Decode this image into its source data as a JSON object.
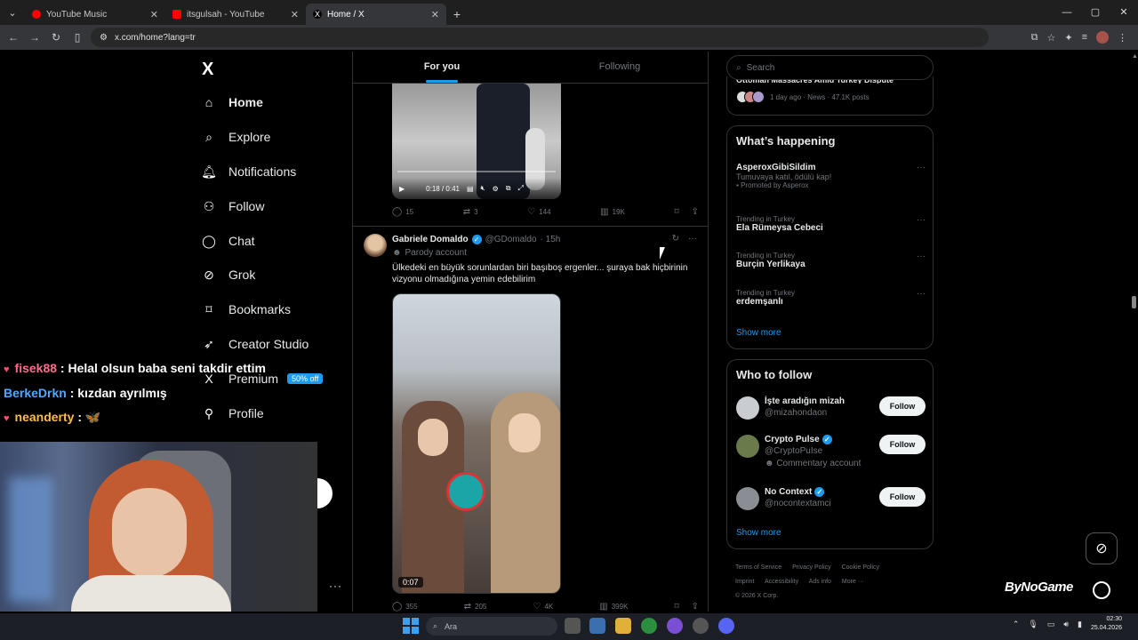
{
  "browser": {
    "tabs": [
      {
        "title": "YouTube Music",
        "favicon_color": "#ff0000",
        "active": false
      },
      {
        "title": "itsgulsah - YouTube",
        "favicon_color": "#ff0000",
        "active": false
      },
      {
        "title": "Home / X",
        "favicon_color": "#000000",
        "active": true
      }
    ],
    "url": "x.com/home?lang=tr"
  },
  "left_nav": {
    "logo": "X",
    "items": [
      {
        "label": "Home",
        "icon": "home-icon",
        "glyph": "⌂"
      },
      {
        "label": "Explore",
        "icon": "search-icon",
        "glyph": "⌕"
      },
      {
        "label": "Notifications",
        "icon": "bell-icon",
        "glyph": "♫"
      },
      {
        "label": "Follow",
        "icon": "add-user-icon",
        "glyph": "⚇"
      },
      {
        "label": "Chat",
        "icon": "chat-bubble-icon",
        "glyph": "◯"
      },
      {
        "label": "Grok",
        "icon": "grok-icon",
        "glyph": "⊘"
      },
      {
        "label": "Bookmarks",
        "icon": "bookmark-icon",
        "glyph": "⌑"
      },
      {
        "label": "Creator Studio",
        "icon": "rocket-icon",
        "glyph": "➶"
      },
      {
        "label": "Premium",
        "icon": "x-logo-icon",
        "glyph": "X"
      },
      {
        "label": "Profile",
        "icon": "person-icon",
        "glyph": "⚲"
      }
    ],
    "premium_badge": "50% off",
    "more": "···"
  },
  "stream_chat": [
    {
      "user": "fisek88",
      "message": " : Helal olsun baba seni takdir ettim"
    },
    {
      "user": "BerkeDrkn",
      "message": " : kızdan ayrılmış"
    },
    {
      "user": "neanderty",
      "message": " : 🦋"
    }
  ],
  "feed": {
    "tabs": [
      "For you",
      "Following"
    ],
    "post1": {
      "video_time": "0:18 / 0:41",
      "replies": "15",
      "reposts": "3",
      "likes": "144",
      "views": "19K"
    },
    "post2": {
      "name": "Gabriele Domaldo",
      "handle": "@GDomaldo",
      "time": "· 15h",
      "label": "Parody account",
      "text": "Ülkedeki en büyük sorunlardan biri başıboş ergenler... şuraya bak hiçbirinin vizyonu olmadığına yemin edebilirim",
      "video_duration": "0:07",
      "replies": "355",
      "reposts": "205",
      "likes": "4K",
      "views": "399K"
    }
  },
  "sidebar": {
    "search_placeholder": "Search",
    "news": {
      "title": "Ottoman Massacres Amid Turkey Dispute",
      "meta": "1 day ago · News · 47.1K posts"
    },
    "whats_happening": {
      "title": "What’s happening",
      "trends": [
        {
          "category": "",
          "title": "AsperoxGibiSildim",
          "sub": "Tumuvaya katıl, ödülü kap!",
          "promoted": "Promoted by Asperox"
        },
        {
          "category": "Trending in Turkey",
          "title": "Ela Rümeysa Cebeci",
          "sub": "",
          "promoted": ""
        },
        {
          "category": "Trending in Turkey",
          "title": "Burçin Yerlikaya",
          "sub": "",
          "promoted": ""
        },
        {
          "category": "Trending in Turkey",
          "title": "erdemşanlı",
          "sub": "",
          "promoted": ""
        }
      ],
      "show_more": "Show more"
    },
    "who_to_follow": {
      "title": "Who to follow",
      "accounts": [
        {
          "name": "İşte aradığın mizah",
          "handle": "@mizahondaon",
          "verified": false,
          "extra": "",
          "follow": "Follow"
        },
        {
          "name": "Crypto Pulse",
          "handle": "@CryptoPuIse",
          "verified": true,
          "extra": "Commentary account",
          "follow": "Follow"
        },
        {
          "name": "No Context",
          "handle": "@nocontextamci",
          "verified": true,
          "extra": "",
          "follow": "Follow"
        }
      ],
      "show_more": "Show more"
    },
    "footer": [
      "Terms of Service",
      "Privacy Policy",
      "Cookie Policy",
      "Imprint",
      "Accessibility",
      "Ads info",
      "More ···",
      "© 2026 X Corp."
    ]
  },
  "overlay": {
    "watermark": "ByNoGame"
  },
  "taskbar": {
    "search_placeholder": "Ara",
    "time": "02:30",
    "date": "25.04.2026"
  }
}
